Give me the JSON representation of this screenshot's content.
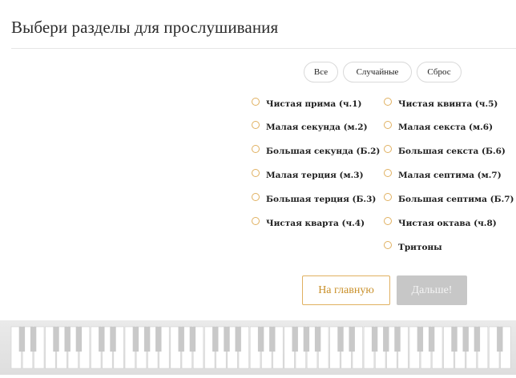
{
  "header": {
    "title": "Выбери разделы для прослушивания"
  },
  "filters": {
    "all_label": "Все",
    "random_label": "Случайные",
    "reset_label": "Сброс"
  },
  "intervals": {
    "left": [
      {
        "label": "Чистая прима (ч.1)",
        "checked": false
      },
      {
        "label": "Малая секунда (м.2)",
        "checked": false
      },
      {
        "label": "Большая секунда (Б.2)",
        "checked": false
      },
      {
        "label": "Малая терция (м.3)",
        "checked": false
      },
      {
        "label": "Большая терция (Б.3)",
        "checked": false
      },
      {
        "label": "Чистая кварта (ч.4)",
        "checked": false
      }
    ],
    "right": [
      {
        "label": "Чистая квинта (ч.5)",
        "checked": false
      },
      {
        "label": "Малая секста (м.6)",
        "checked": false
      },
      {
        "label": "Большая секста (Б.6)",
        "checked": false
      },
      {
        "label": "Малая септима (м.7)",
        "checked": false
      },
      {
        "label": "Большая септима (Б.7)",
        "checked": false
      },
      {
        "label": "Чистая октава (ч.8)",
        "checked": false
      },
      {
        "label": "Тритоны",
        "checked": false
      }
    ]
  },
  "actions": {
    "home_label": "На главную",
    "next_label": "Дальше!",
    "next_disabled": true
  },
  "colors": {
    "accent": "#e0b060",
    "accent_text": "#c9902a",
    "disabled_bg": "#c7c7c7"
  },
  "decoration": {
    "piano_icon": "piano-keyboard-icon"
  }
}
